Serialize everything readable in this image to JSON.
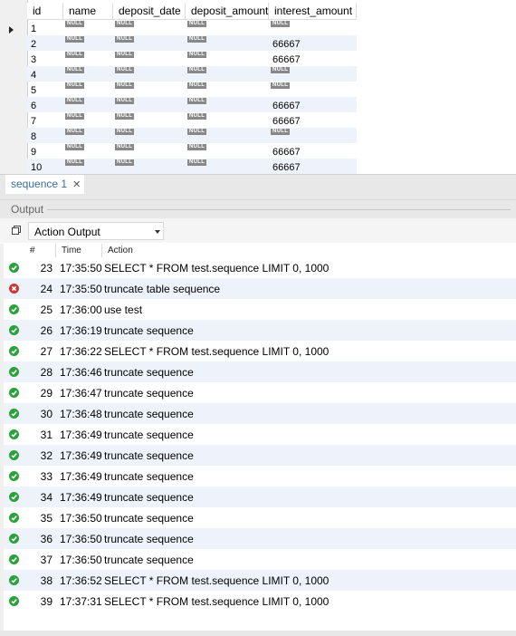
{
  "grid": {
    "columns": [
      "id",
      "name",
      "deposit_date",
      "deposit_amount",
      "interest_amount"
    ],
    "null_label": "NULL",
    "rows": [
      {
        "id": "1",
        "interest_amount": "NULL"
      },
      {
        "id": "2",
        "interest_amount": "66667"
      },
      {
        "id": "3",
        "interest_amount": "66667"
      },
      {
        "id": "4",
        "interest_amount": "NULL"
      },
      {
        "id": "5",
        "interest_amount": "NULL"
      },
      {
        "id": "6",
        "interest_amount": "66667"
      },
      {
        "id": "7",
        "interest_amount": "66667"
      },
      {
        "id": "8",
        "interest_amount": "NULL"
      },
      {
        "id": "9",
        "interest_amount": "66667"
      },
      {
        "id": "10",
        "interest_amount": "66667"
      }
    ]
  },
  "tabs": [
    {
      "label": "sequence 1",
      "close": "✕"
    }
  ],
  "output": {
    "title": "Output",
    "selector_value": "Action Output",
    "headers": {
      "num": "#",
      "time": "Time",
      "action": "Action"
    },
    "entries": [
      {
        "status": "ok",
        "num": "23",
        "time": "17:35:50",
        "action": "SELECT * FROM test.sequence LIMIT 0, 1000"
      },
      {
        "status": "err",
        "num": "24",
        "time": "17:35:50",
        "action": "truncate table sequence"
      },
      {
        "status": "ok",
        "num": "25",
        "time": "17:36:00",
        "action": "use test"
      },
      {
        "status": "ok",
        "num": "26",
        "time": "17:36:19",
        "action": "truncate sequence"
      },
      {
        "status": "ok",
        "num": "27",
        "time": "17:36:22",
        "action": "SELECT * FROM test.sequence LIMIT 0, 1000"
      },
      {
        "status": "ok",
        "num": "28",
        "time": "17:36:46",
        "action": "truncate sequence"
      },
      {
        "status": "ok",
        "num": "29",
        "time": "17:36:47",
        "action": "truncate sequence"
      },
      {
        "status": "ok",
        "num": "30",
        "time": "17:36:48",
        "action": "truncate sequence"
      },
      {
        "status": "ok",
        "num": "31",
        "time": "17:36:49",
        "action": "truncate sequence"
      },
      {
        "status": "ok",
        "num": "32",
        "time": "17:36:49",
        "action": "truncate sequence"
      },
      {
        "status": "ok",
        "num": "33",
        "time": "17:36:49",
        "action": "truncate sequence"
      },
      {
        "status": "ok",
        "num": "34",
        "time": "17:36:49",
        "action": "truncate sequence"
      },
      {
        "status": "ok",
        "num": "35",
        "time": "17:36:50",
        "action": "truncate sequence"
      },
      {
        "status": "ok",
        "num": "36",
        "time": "17:36:50",
        "action": "truncate sequence"
      },
      {
        "status": "ok",
        "num": "37",
        "time": "17:36:50",
        "action": "truncate sequence"
      },
      {
        "status": "ok",
        "num": "38",
        "time": "17:36:52",
        "action": "SELECT * FROM test.sequence LIMIT 0, 1000"
      },
      {
        "status": "ok",
        "num": "39",
        "time": "17:37:31",
        "action": "SELECT * FROM test.sequence LIMIT 0, 1000"
      }
    ]
  },
  "icons": {
    "current_row": "row-pointer-icon",
    "copy": "copy-icon",
    "success": "success-check-icon",
    "error": "error-x-icon"
  },
  "colors": {
    "success": "#2aa13a",
    "error": "#c93b3b",
    "tab_text": "#3a6ea5",
    "alt_row": "#eef3fb"
  }
}
